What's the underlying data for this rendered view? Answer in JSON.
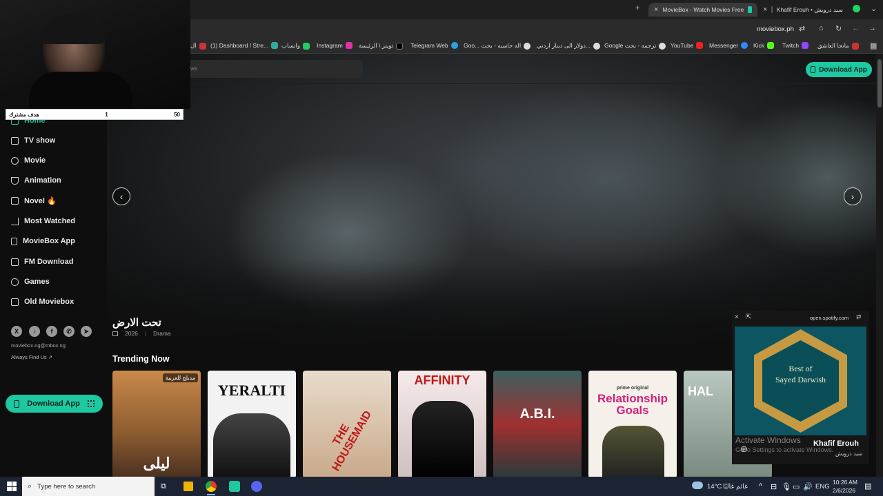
{
  "browser": {
    "tabs": [
      {
        "title": "MovieBox - Watch Movies Free",
        "active": true
      },
      {
        "title": "Khafif Erouh • سيد درويش",
        "active": false
      }
    ],
    "url": "moviebox.ph",
    "bookmarks": [
      "ال",
      "(1) Dashboard / Stre...",
      "واتساب",
      "Instagram",
      "تويتر \\ الرئيسة",
      "Telegram Web",
      "Goo... اله حاسبه - بحث",
      "دولار الى دينار اردني...",
      "Google ترجمه - بحث",
      "YouTube",
      "Messenger",
      "Kick",
      "Twitch",
      "مانجا العاشق"
    ]
  },
  "site": {
    "search_placeholder": "ws",
    "download_app": "Download App",
    "nav": [
      {
        "label": "Home",
        "icon": "home-icon"
      },
      {
        "label": "TV show",
        "icon": "tv-icon"
      },
      {
        "label": "Movie",
        "icon": "movie-icon"
      },
      {
        "label": "Animation",
        "icon": "animation-icon"
      },
      {
        "label": "Novel 🔥",
        "icon": "book-icon"
      },
      {
        "label": "Most Watched",
        "icon": "chart-icon"
      },
      {
        "label": "MovieBox App",
        "icon": "phone-icon"
      },
      {
        "label": "FM Download",
        "icon": "download-icon"
      },
      {
        "label": "Games",
        "icon": "gamepad-icon"
      },
      {
        "label": "Old Moviebox",
        "icon": "archive-icon"
      }
    ],
    "email": "moviebox.ng@mbox.ng",
    "always_find_us": "Always Find Us",
    "hero": {
      "title": "تحت الارض",
      "year": "2026",
      "genre": "Drama"
    },
    "trending_title": "Trending Now",
    "posters": [
      {
        "badge": "مدبلج للعربية",
        "text": "ليلى",
        "color": "#a06a3a"
      },
      {
        "text": "YERALTI",
        "color": "#ddd"
      },
      {
        "text": "THE HOUSEMAID",
        "color": "#b89a7a"
      },
      {
        "text": "AFFINITY",
        "color": "#c02020"
      },
      {
        "text": "A.B.I.",
        "color": "#3a5a5a"
      },
      {
        "text": "Relationship Goals",
        "color": "#f5f0ea",
        "sub": "prime original"
      },
      {
        "text": "HAL",
        "color": "#9ab0a8"
      }
    ]
  },
  "overlay": {
    "goal_label": "هدف مشترك",
    "goal_current": "1",
    "goal_target": "50"
  },
  "spotify": {
    "host": "open.spotify.com",
    "album_line1": "Best of",
    "album_line2": "Sayed Darwish",
    "track": "Khafif Erouh",
    "artist": "سيد درويش"
  },
  "windows": {
    "activate_title": "Activate Windows",
    "activate_sub": "Go to Settings to activate Windows.",
    "search_placeholder": "Type here to search",
    "weather": "14°C",
    "weather_text": "غائم غالبًا",
    "lang": "ENG",
    "time": "10:26 AM",
    "date": "2/6/2026"
  },
  "colors": {
    "accent": "#1ec8a0",
    "taskbar": "#1c2333"
  }
}
